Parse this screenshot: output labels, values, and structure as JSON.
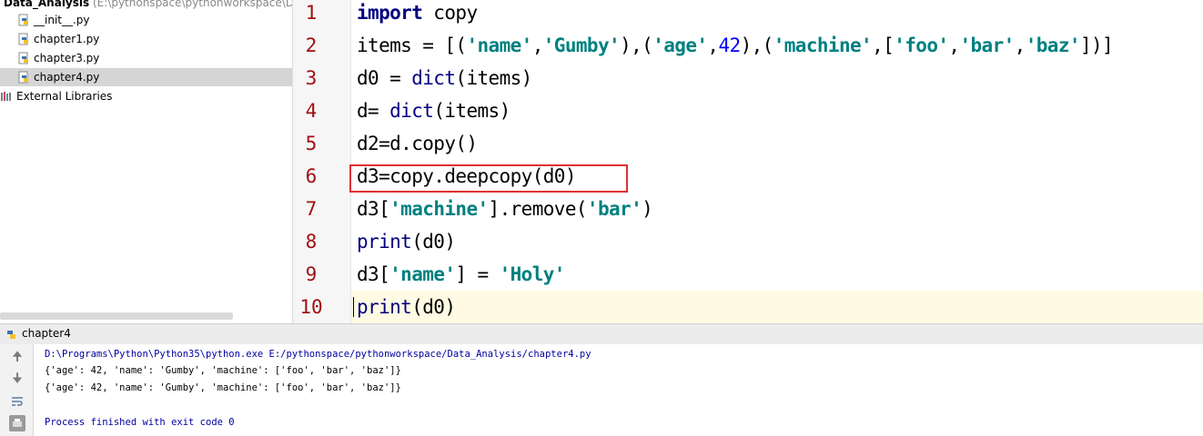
{
  "project_tree": {
    "root": {
      "label": "Data_Analysis",
      "path": "(E:\\pythonspace\\pythonworkspace\\D"
    },
    "files": [
      {
        "label": "__init__.py"
      },
      {
        "label": "chapter1.py"
      },
      {
        "label": "chapter3.py"
      },
      {
        "label": "chapter4.py",
        "selected": true
      }
    ],
    "external": "External Libraries"
  },
  "editor": {
    "line_numbers": [
      "1",
      "2",
      "3",
      "4",
      "5",
      "6",
      "7",
      "8",
      "9",
      "10"
    ],
    "lines": [
      [
        {
          "t": "kw",
          "v": "import"
        },
        {
          "t": "p",
          "v": " copy"
        }
      ],
      [
        {
          "t": "p",
          "v": "items = [("
        },
        {
          "t": "str",
          "v": "'name'"
        },
        {
          "t": "p",
          "v": ","
        },
        {
          "t": "str",
          "v": "'Gumby'"
        },
        {
          "t": "p",
          "v": "),("
        },
        {
          "t": "str",
          "v": "'age'"
        },
        {
          "t": "p",
          "v": ","
        },
        {
          "t": "num",
          "v": "42"
        },
        {
          "t": "p",
          "v": "),("
        },
        {
          "t": "str",
          "v": "'machine'"
        },
        {
          "t": "p",
          "v": ",["
        },
        {
          "t": "str",
          "v": "'foo'"
        },
        {
          "t": "p",
          "v": ","
        },
        {
          "t": "str",
          "v": "'bar'"
        },
        {
          "t": "p",
          "v": ","
        },
        {
          "t": "str",
          "v": "'baz'"
        },
        {
          "t": "p",
          "v": "])]"
        }
      ],
      [
        {
          "t": "p",
          "v": "d0 = "
        },
        {
          "t": "bi",
          "v": "dict"
        },
        {
          "t": "p",
          "v": "(items)"
        }
      ],
      [
        {
          "t": "p",
          "v": "d= "
        },
        {
          "t": "bi",
          "v": "dict"
        },
        {
          "t": "p",
          "v": "(items)"
        }
      ],
      [
        {
          "t": "p",
          "v": "d2=d.copy()"
        }
      ],
      [
        {
          "t": "p",
          "v": "d3=copy.deepcopy(d0)"
        }
      ],
      [
        {
          "t": "p",
          "v": "d3["
        },
        {
          "t": "str",
          "v": "'machine'"
        },
        {
          "t": "p",
          "v": "].remove("
        },
        {
          "t": "str",
          "v": "'bar'"
        },
        {
          "t": "p",
          "v": ")"
        }
      ],
      [
        {
          "t": "bi",
          "v": "print"
        },
        {
          "t": "p",
          "v": "(d0)"
        }
      ],
      [
        {
          "t": "p",
          "v": "d3["
        },
        {
          "t": "str",
          "v": "'name'"
        },
        {
          "t": "p",
          "v": "] = "
        },
        {
          "t": "str",
          "v": "'Holy'"
        }
      ],
      [
        {
          "t": "bi",
          "v": "print"
        },
        {
          "t": "p",
          "v": "(d0)"
        }
      ]
    ],
    "highlighted_line": 6,
    "current_line": 10
  },
  "run_panel": {
    "title": "chapter4",
    "output": {
      "command": "D:\\Programs\\Python\\Python35\\python.exe E:/pythonspace/pythonworkspace/Data_Analysis/chapter4.py",
      "line1": "{'age': 42, 'name': 'Gumby', 'machine': ['foo', 'bar', 'baz']}",
      "line2": "{'age': 42, 'name': 'Gumby', 'machine': ['foo', 'bar', 'baz']}",
      "exit": "Process finished with exit code 0"
    }
  },
  "colors": {
    "keyword": "#000080",
    "string": "#008080",
    "number": "#0000ff",
    "line_number": "#a01010",
    "highlight_box": "#e03030",
    "current_line_bg": "#fffae3"
  }
}
